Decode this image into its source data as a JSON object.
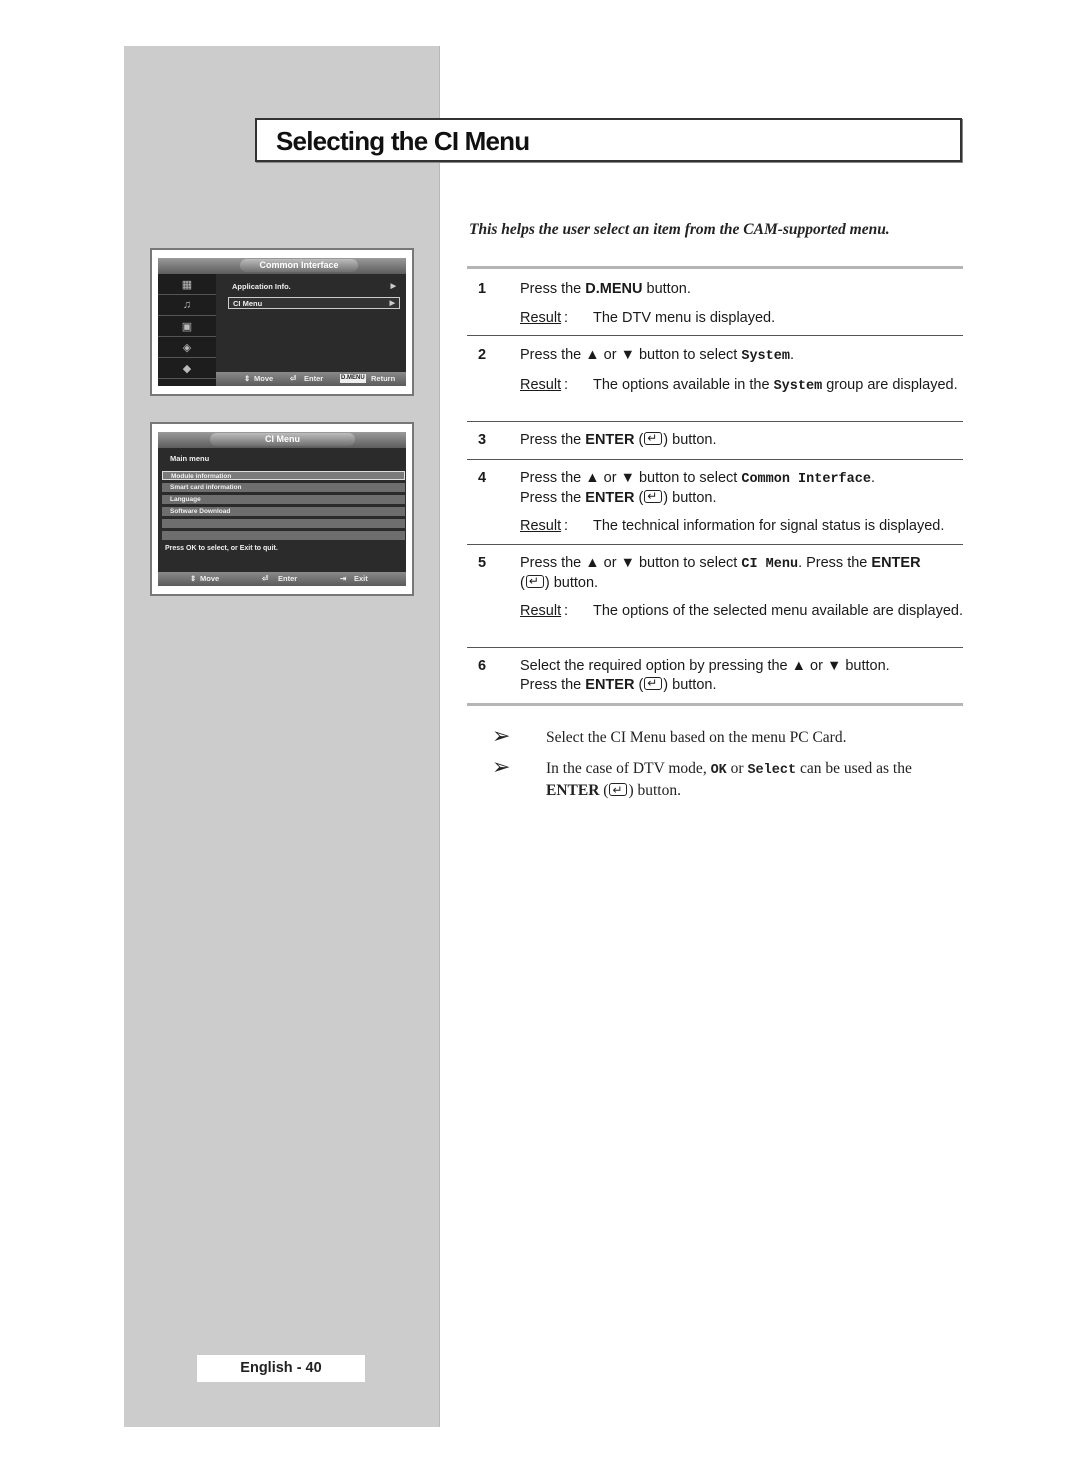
{
  "page": {
    "title": "Selecting the CI Menu",
    "intro": "This helps the user select an item from the CAM-supported menu.",
    "footer": "English - 40"
  },
  "screen_common_interface": {
    "header": "Common Interface",
    "items": [
      {
        "label": "Application Info.",
        "arrow": "▶"
      },
      {
        "label": "CI Menu",
        "arrow": "▶",
        "selected": true
      }
    ],
    "side_icons": [
      "program-icon",
      "sound-icon",
      "picture-icon",
      "channel-icon",
      "setup-icon"
    ],
    "footer": {
      "move": "Move",
      "enter": "Enter",
      "dmenu": "D.MENU",
      "return": "Return"
    }
  },
  "screen_ci_menu": {
    "header": "CI Menu",
    "section": "Main menu",
    "items": [
      "Module information",
      "Smart card information",
      "Language",
      "Software Download",
      "",
      ""
    ],
    "hint": "Press OK to select, or Exit to quit.",
    "footer": {
      "move": "Move",
      "enter": "Enter",
      "exit": "Exit"
    }
  },
  "steps": [
    {
      "num": "1",
      "p1": "Press the ",
      "b1": "D.MENU",
      "p2": " button.",
      "result_label": "Result",
      "result": "The DTV menu is displayed."
    },
    {
      "num": "2",
      "p1": "Press the ▲ or ▼ button to select ",
      "m1": "System",
      "p2": ".",
      "result_label": "Result",
      "r1": "The options available in the ",
      "rm": "System",
      "r2": " group are displayed."
    },
    {
      "num": "3",
      "p1": "Press the ",
      "b1": "ENTER",
      "p2": " (",
      "p3": ") button."
    },
    {
      "num": "4",
      "p1": "Press the ▲ or ▼ button to select ",
      "m1": "Common Interface",
      "p2": ".",
      "l2a": "Press the ",
      "l2b": "ENTER",
      "l2c": " (",
      "l2d": ") button.",
      "result_label": "Result",
      "result": "The technical information for signal status is displayed."
    },
    {
      "num": "5",
      "p1": "Press the ▲ or ▼ button to select ",
      "m1": "CI Menu",
      "p2": ". Press the ",
      "b1": "ENTER",
      "p3": "(",
      "p4": ") button.",
      "result_label": "Result",
      "result": "The options of the selected menu available are displayed."
    },
    {
      "num": "6",
      "p1": "Select the required option by pressing the ▲ or ▼ button.",
      "l2a": "Press the ",
      "l2b": "ENTER",
      "l2c": " (",
      "l2d": ") button."
    }
  ],
  "notes": [
    {
      "arrow": "➢",
      "text": "Select the CI Menu based on the menu PC Card."
    },
    {
      "arrow": "➢",
      "t1": "In the case of DTV mode, ",
      "m1": "OK",
      "t2": " or ",
      "m2": "Select",
      "t3": " can be used as the ",
      "b1": "ENTER",
      "t4": " (",
      "t5": ") button."
    }
  ]
}
